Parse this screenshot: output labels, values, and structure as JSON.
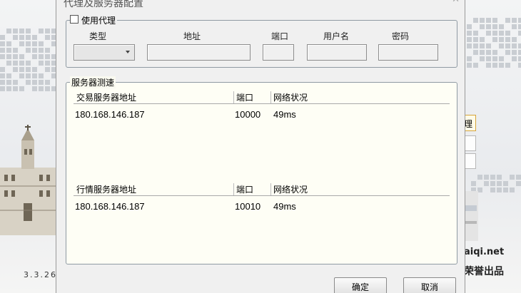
{
  "background": {
    "version_text": "3.3.26.",
    "site_text": "aiqi.net",
    "brand_text": "荣誉出品",
    "side_button_text": "理"
  },
  "dialog": {
    "title": "代理及服务器配置",
    "close_icon": "close-icon"
  },
  "proxy": {
    "checkbox_label": "使用代理",
    "checked": false,
    "columns": {
      "type": "类型",
      "address": "地址",
      "port": "端口",
      "username": "用户名",
      "password": "密码"
    },
    "type_value": "",
    "address_value": "",
    "port_value": "",
    "username_value": "",
    "password_value": ""
  },
  "server_test": {
    "legend": "服务器测速",
    "trade": {
      "headers": {
        "address": "交易服务器地址",
        "port": "端口",
        "network": "网络状况"
      },
      "rows": [
        {
          "address": "180.168.146.187",
          "port": "10000",
          "network": "49ms"
        }
      ]
    },
    "quote": {
      "headers": {
        "address": "行情服务器地址",
        "port": "端口",
        "network": "网络状况"
      },
      "rows": [
        {
          "address": "180.168.146.187",
          "port": "10010",
          "network": "49ms"
        }
      ]
    }
  },
  "buttons": {
    "ok": "确定",
    "cancel": "取消"
  }
}
